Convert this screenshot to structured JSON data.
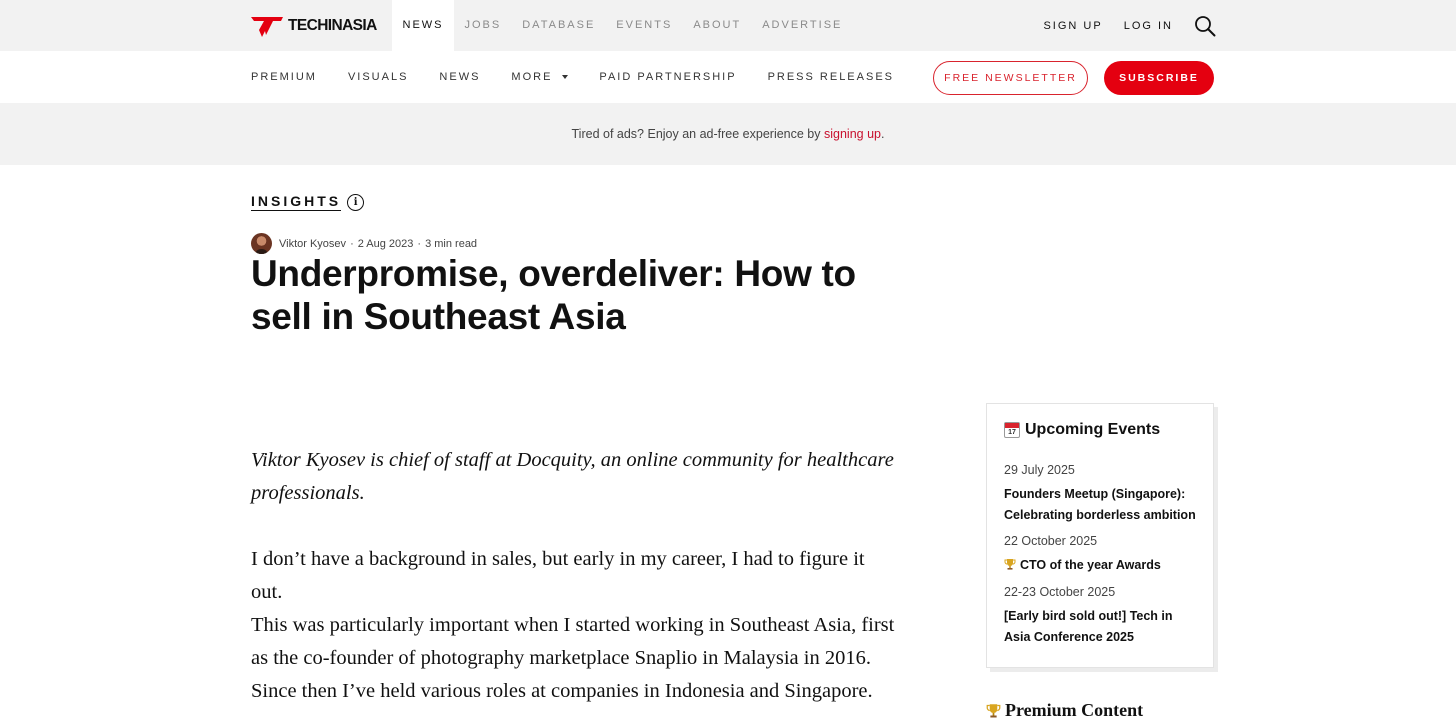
{
  "header": {
    "logo_text": "TECHINASIA",
    "nav": [
      {
        "label": "NEWS",
        "active": true
      },
      {
        "label": "JOBS",
        "active": false
      },
      {
        "label": "DATABASE",
        "active": false
      },
      {
        "label": "EVENTS",
        "active": false
      },
      {
        "label": "ABOUT",
        "active": false
      },
      {
        "label": "ADVERTISE",
        "active": false
      }
    ],
    "sign_up": "SIGN UP",
    "log_in": "LOG IN",
    "search_icon": "search-icon"
  },
  "subnav": {
    "items": [
      "PREMIUM",
      "VISUALS",
      "NEWS",
      "MORE",
      "PAID PARTNERSHIP",
      "PRESS RELEASES"
    ],
    "free_newsletter": "FREE NEWSLETTER",
    "subscribe": "SUBSCRIBE"
  },
  "ad_banner": {
    "text": "Tired of ads? Enjoy an ad-free experience by ",
    "link": "signing up",
    "suffix": "."
  },
  "article": {
    "category": "INSIGHTS",
    "author": "Viktor Kyosev",
    "date": "2 Aug 2023",
    "read_time": "3 min read",
    "title": "Underpromise, overdeliver: How to sell in Southeast Asia",
    "lede": "Viktor Kyosev is chief of staff at Docquity, an online community for healthcare professionals.",
    "paragraphs": [
      "I don’t have a background in sales, but early in my career, I had to figure it out.",
      "This was particularly important when I started working in Southeast Asia, first as the co-founder of photography marketplace Snaplio in Malaysia in 2016. Since then I’ve held various roles at companies in Indonesia and Singapore."
    ]
  },
  "events": {
    "title": "Upcoming Events",
    "items": [
      {
        "date": "29 July 2025",
        "name": "Founders Meetup (Singapore): Celebrating borderless ambition"
      },
      {
        "date": "22 October 2025",
        "name": "CTO of the year Awards"
      },
      {
        "date": "22-23 October 2025",
        "name": "[Early bird sold out!] Tech in Asia Conference 2025"
      }
    ]
  },
  "premium": {
    "title": "Premium Content"
  },
  "colors": {
    "brand_red": "#e40010",
    "link_red": "#c8102e"
  }
}
